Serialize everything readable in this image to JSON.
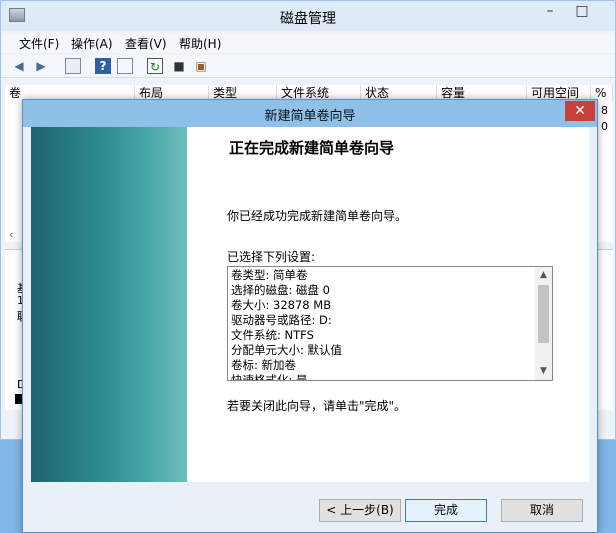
{
  "window": {
    "title": "磁盘管理",
    "minimize": "–",
    "maximize": "□"
  },
  "menu": [
    "文件(F)",
    "操作(A)",
    "查看(V)",
    "帮助(H)"
  ],
  "toolbar": {
    "icons": [
      "back-icon",
      "forward-icon",
      "properties-icon",
      "help-icon",
      "list-view-icon",
      "refresh-icon",
      "rescan-icon",
      "disk-icon"
    ]
  },
  "columns": [
    "卷",
    "布局",
    "类型",
    "文件系统",
    "状态",
    "容量",
    "可用空间",
    "%"
  ],
  "background_fragments": {
    "col_pct_1": "8",
    "col_pct_2": "0",
    "lower_1": "基",
    "lower_2": "1",
    "lower_3": "联",
    "lower_4": "D"
  },
  "wizard": {
    "title": "新建简单卷向导",
    "close": "✕",
    "heading": "正在完成新建简单卷向导",
    "message": "你已经成功完成新建简单卷向导。",
    "settings_label": "已选择下列设置:",
    "settings": [
      "卷类型: 简单卷",
      "选择的磁盘: 磁盘 0",
      "卷大小: 32878 MB",
      "驱动器号或路径: D:",
      "文件系统: NTFS",
      "分配单元大小: 默认值",
      "卷标: 新加卷",
      "快速格式化: 是"
    ],
    "footer_note": "若要关闭此向导，请单击\"完成\"。",
    "buttons": {
      "back": "< 上一步(B)",
      "finish": "完成",
      "cancel": "取消"
    }
  }
}
